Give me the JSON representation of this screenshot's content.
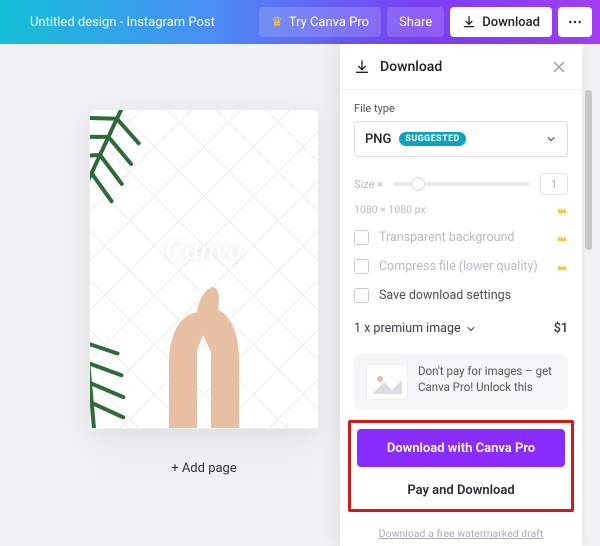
{
  "header": {
    "title": "Untitled design - Instagram Post",
    "try_pro": "Try Canva Pro",
    "share": "Share",
    "download": "Download",
    "more_aria": "More options"
  },
  "canvas": {
    "logo_text": "Canva",
    "add_page": "+ Add page"
  },
  "panel": {
    "title": "Download",
    "file_type_label": "File type",
    "file_type_value": "PNG",
    "file_type_badge": "SUGGESTED",
    "size_label": "Size ×",
    "size_value": "1",
    "dimensions": "1080 × 1080 px",
    "opt_transparent": "Transparent background",
    "opt_compress": "Compress file (lower quality)",
    "opt_save": "Save download settings",
    "premium_line": "1 x premium image",
    "premium_price": "$1",
    "upsell_text": "Don't pay for images – get Canva Pro! Unlock this",
    "cta": "Download with Canva Pro",
    "cta_secondary": "Pay and Download",
    "watermark_link": "Download a free watermarked draft"
  }
}
